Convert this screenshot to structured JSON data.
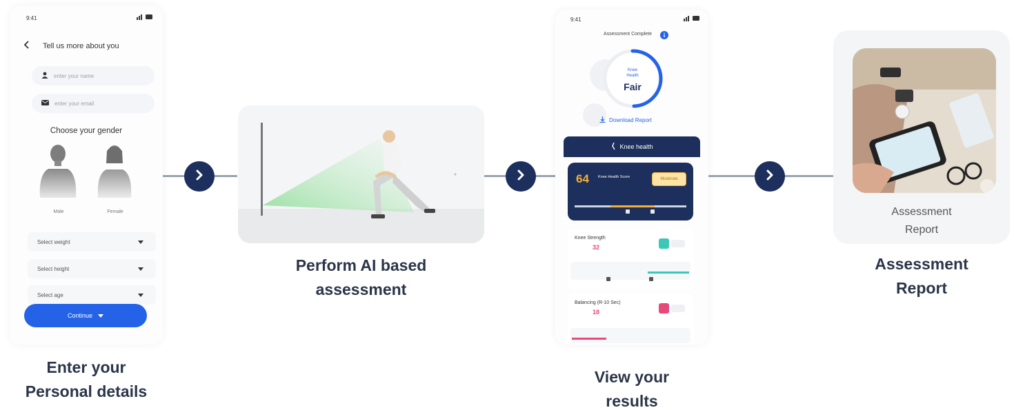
{
  "step1": {
    "status_time": "9:41",
    "title": "Tell us more about you",
    "name_placeholder": "enter your name",
    "email_placeholder": "enter your email",
    "gender_title": "Choose your gender",
    "male_label": "Male",
    "female_label": "Female",
    "weight_select": "Select weight",
    "height_select": "Select height",
    "age_select": "Select age",
    "continue_label": "Continue",
    "caption_line1": "Enter your",
    "caption_line2": "Personal details"
  },
  "step2": {
    "caption_line1": "Perform AI based",
    "caption_line2": "assessment"
  },
  "step3": {
    "status_time": "9:41",
    "completed_label": "Assessment Complete",
    "gauge_label_line1": "Knee",
    "gauge_label_line2": "Health",
    "gauge_value": "Fair",
    "download_label": "Download Report",
    "tab_label": "Knee health",
    "score": "64",
    "score_label": "Knee Health Score",
    "score_badge": "Moderate",
    "metric1_title": "Knee Strength",
    "metric1_value": "32",
    "metric2_title": "Balancing (R-10 Sec)",
    "metric2_value": "18",
    "caption_line1": "View your",
    "caption_line2": "results"
  },
  "step4": {
    "card_label_line1": "Assessment",
    "card_label_line2": "Report",
    "caption_line1": "Assessment",
    "caption_line2": "Report"
  },
  "colors": {
    "navy": "#1d2f5c",
    "blue": "#2463e8",
    "green_beam": "#8fd98f",
    "orange": "#f2b13a",
    "teal": "#3cc7b7",
    "pink": "#e8487a"
  },
  "icons": [
    "chevron-right-icon",
    "back-arrow-icon",
    "user-icon",
    "mail-icon",
    "chevron-down-icon",
    "info-icon",
    "download-icon",
    "knee-icon"
  ]
}
